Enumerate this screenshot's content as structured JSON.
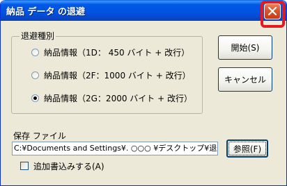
{
  "window": {
    "title": "納品 データ の退避"
  },
  "group": {
    "legend": "退避種別",
    "options": [
      {
        "label": "納品情報（1D： 450 バイト + 改行）",
        "selected": false
      },
      {
        "label": "納品情報（2F：1000 バイト + 改行）",
        "selected": false
      },
      {
        "label": "納品情報（2G：2000 バイト + 改行）",
        "selected": true
      }
    ]
  },
  "buttons": {
    "start": "開始(S)",
    "cancel": "キャンセル",
    "browse": "参照(F)"
  },
  "save": {
    "label": "保存 ファイル",
    "path": "C:¥Documents and Settings¥. ○○○ ¥デスクトップ¥退避"
  },
  "append": {
    "label": "追加書込みする(A)",
    "checked": false
  },
  "colors": {
    "titlebar": "#0054e3",
    "face": "#ece9d8",
    "highlight": "#e8191e"
  }
}
